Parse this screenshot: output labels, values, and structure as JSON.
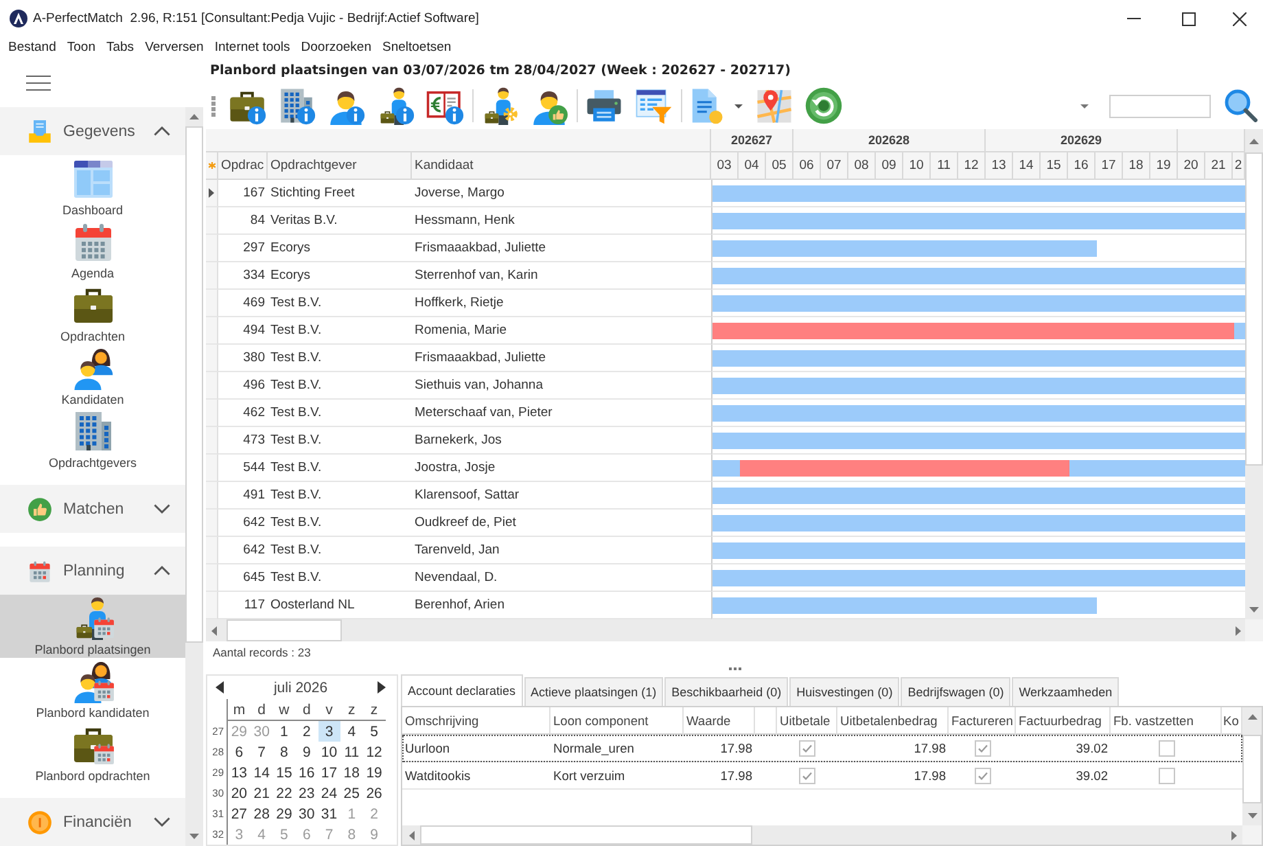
{
  "window": {
    "title": "A-PerfectMatch  2.96, R:151 [Consultant:Pedja Vujic - Bedrijf:Actief Software]"
  },
  "menu": [
    "Bestand",
    "Toon",
    "Tabs",
    "Verversen",
    "Internet tools",
    "Doorzoeken",
    "Sneltoetsen"
  ],
  "sidebar": {
    "sections": [
      {
        "label": "Gegevens",
        "kind": "data",
        "expanded": true,
        "items": [
          {
            "label": "Dashboard",
            "kind": "dashboard",
            "selected": false
          },
          {
            "label": "Agenda",
            "kind": "agenda",
            "selected": false
          },
          {
            "label": "Opdrachten",
            "kind": "assignments",
            "selected": false
          },
          {
            "label": "Kandidaten",
            "kind": "candidates",
            "selected": false
          },
          {
            "label": "Opdrachtgevers",
            "kind": "clients",
            "selected": false
          }
        ]
      },
      {
        "label": "Matchen",
        "kind": "matching",
        "expanded": false
      },
      {
        "label": "Planning",
        "kind": "planning",
        "expanded": true,
        "items": [
          {
            "label": "Planbord plaatsingen",
            "kind": "placementboard",
            "selected": true
          },
          {
            "label": "Planbord kandidaten",
            "kind": "candidateboard",
            "selected": false
          },
          {
            "label": "Planbord opdrachten",
            "kind": "assignmentboard",
            "selected": false
          }
        ]
      },
      {
        "label": "Financiën",
        "kind": "finance",
        "expanded": false
      }
    ]
  },
  "planboard": {
    "title": "Planbord plaatsingen van 03/07/2026 tm 28/04/2027 (Week : 202627 - 202717)",
    "columns": [
      "Opdrac",
      "Opdrachtgever",
      "Kandidaat"
    ],
    "weeks": [
      {
        "label": "202627",
        "days": [
          "03",
          "04",
          "05"
        ]
      },
      {
        "label": "202628",
        "days": [
          "06",
          "07",
          "08",
          "09",
          "10",
          "11",
          "12"
        ]
      },
      {
        "label": "202629",
        "days": [
          "13",
          "14",
          "15",
          "16",
          "17",
          "18",
          "19"
        ]
      },
      {
        "days": [
          "20",
          "21",
          "2"
        ]
      }
    ],
    "rows": [
      {
        "nr": "167",
        "client": "Stichting Freet",
        "candidate": "Joverse, Margo",
        "current": true,
        "bars": [
          {
            "color": "#9ccbfa",
            "level": 1
          }
        ]
      },
      {
        "nr": "84",
        "client": "Veritas B.V.",
        "candidate": "Hessmann, Henk",
        "current": false,
        "bars": [
          {
            "color": "#9ccbfa",
            "level": 1
          }
        ]
      },
      {
        "nr": "297",
        "client": "Ecorys",
        "candidate": "Frismaaakbad, Juliette",
        "current": false,
        "bars": [
          {
            "color": "#9ccbfa",
            "level": 0.722
          }
        ]
      },
      {
        "nr": "334",
        "client": "Ecorys",
        "candidate": "Sterrenhof van, Karin",
        "current": false,
        "bars": [
          {
            "color": "#9ccbfa",
            "level": 1
          }
        ]
      },
      {
        "nr": "469",
        "client": "Test B.V.",
        "candidate": "Hoffkerk, Rietje",
        "current": false,
        "bars": [
          {
            "color": "#9ccbfa",
            "level": 1
          }
        ]
      },
      {
        "nr": "494",
        "client": "Test B.V.",
        "candidate": "Romenia, Marie",
        "current": false,
        "bars": [
          {
            "color": "#ff8080",
            "level": 0.979
          },
          {
            "color": "#9ccbfa",
            "level": 0.021
          }
        ]
      },
      {
        "nr": "380",
        "client": "Test B.V.",
        "candidate": "Frismaaakbad, Juliette",
        "current": false,
        "bars": [
          {
            "color": "#9ccbfa",
            "level": 1
          }
        ]
      },
      {
        "nr": "496",
        "client": "Test B.V.",
        "candidate": "Siethuis van, Johanna",
        "current": false,
        "bars": [
          {
            "color": "#9ccbfa",
            "level": 1
          }
        ]
      },
      {
        "nr": "462",
        "client": "Test B.V.",
        "candidate": "Meterschaaf van, Pieter",
        "current": false,
        "bars": [
          {
            "color": "#9ccbfa",
            "level": 1
          }
        ]
      },
      {
        "nr": "473",
        "client": "Test B.V.",
        "candidate": "Barnekerk, Jos",
        "current": false,
        "bars": [
          {
            "color": "#9ccbfa",
            "level": 1
          }
        ]
      },
      {
        "nr": "544",
        "client": "Test B.V.",
        "candidate": "Joostra, Josje",
        "current": false,
        "bars": [
          {
            "color": "#9ccbfa",
            "level": 0.052
          },
          {
            "color": "#ff8080"
          },
          {
            "color": "#9ccbfa",
            "level": 0.329
          }
        ]
      },
      {
        "nr": "491",
        "client": "Test B.V.",
        "candidate": "Klarensoof, Sattar",
        "current": false,
        "bars": [
          {
            "color": "#9ccbfa",
            "level": 1
          }
        ]
      },
      {
        "nr": "642",
        "client": "Test B.V.",
        "candidate": "Oudkreef de, Piet",
        "current": false,
        "bars": [
          {
            "color": "#9ccbfa",
            "level": 1
          }
        ]
      },
      {
        "nr": "642",
        "client": "Test B.V.",
        "candidate": "Tarenveld, Jan",
        "current": false,
        "bars": [
          {
            "color": "#9ccbfa",
            "level": 1
          }
        ]
      },
      {
        "nr": "645",
        "client": "Test B.V.",
        "candidate": "Nevendaal, D.",
        "current": false,
        "bars": [
          {
            "color": "#9ccbfa",
            "level": 1
          }
        ]
      },
      {
        "nr": "117",
        "client": "Oosterland NL",
        "candidate": "Berenhof, Arien",
        "current": false,
        "bars": [
          {
            "color": "#9ccbfa",
            "level": 0.722
          }
        ]
      }
    ],
    "record_count": "Aantal records : 23"
  },
  "calendar": {
    "month": "juli 2026",
    "weekdays": [
      "m",
      "d",
      "w",
      "d",
      "v",
      "z",
      "z"
    ],
    "weeks": [
      {
        "number": "27",
        "days": [
          {
            "day": "29",
            "outside": true,
            "selected": false
          },
          {
            "day": "30",
            "outside": true,
            "selected": false
          },
          {
            "day": "1",
            "outside": false,
            "selected": false
          },
          {
            "day": "2",
            "outside": false,
            "selected": false
          },
          {
            "day": "3",
            "outside": false,
            "selected": true
          },
          {
            "day": "4",
            "outside": false,
            "selected": false
          },
          {
            "day": "5",
            "outside": false,
            "selected": false
          }
        ]
      },
      {
        "number": "28",
        "days": [
          {
            "day": "6",
            "outside": false,
            "selected": false
          },
          {
            "day": "7",
            "outside": false,
            "selected": false
          },
          {
            "day": "8",
            "outside": false,
            "selected": false
          },
          {
            "day": "9",
            "outside": false,
            "selected": false
          },
          {
            "day": "10",
            "outside": false,
            "selected": false
          },
          {
            "day": "11",
            "outside": false,
            "selected": false
          },
          {
            "day": "12",
            "outside": false,
            "selected": false
          }
        ]
      },
      {
        "number": "29",
        "days": [
          {
            "day": "13",
            "outside": false,
            "selected": false
          },
          {
            "day": "14",
            "outside": false,
            "selected": false
          },
          {
            "day": "15",
            "outside": false,
            "selected": false
          },
          {
            "day": "16",
            "outside": false,
            "selected": false
          },
          {
            "day": "17",
            "outside": false,
            "selected": false
          },
          {
            "day": "18",
            "outside": false,
            "selected": false
          },
          {
            "day": "19",
            "outside": false,
            "selected": false
          }
        ]
      },
      {
        "number": "30",
        "days": [
          {
            "day": "20",
            "outside": false,
            "selected": false
          },
          {
            "day": "21",
            "outside": false,
            "selected": false
          },
          {
            "day": "22",
            "outside": false,
            "selected": false
          },
          {
            "day": "23",
            "outside": false,
            "selected": false
          },
          {
            "day": "24",
            "outside": false,
            "selected": false
          },
          {
            "day": "25",
            "outside": false,
            "selected": false
          },
          {
            "day": "26",
            "outside": false,
            "selected": false
          }
        ]
      },
      {
        "number": "31",
        "days": [
          {
            "day": "27",
            "outside": false,
            "selected": false
          },
          {
            "day": "28",
            "outside": false,
            "selected": false
          },
          {
            "day": "29",
            "outside": false,
            "selected": false
          },
          {
            "day": "30",
            "outside": false,
            "selected": false
          },
          {
            "day": "31",
            "outside": false,
            "selected": false
          },
          {
            "day": "1",
            "outside": true,
            "selected": false
          },
          {
            "day": "2",
            "outside": true,
            "selected": false
          }
        ]
      },
      {
        "number": "32",
        "days": [
          {
            "day": "3",
            "outside": true,
            "selected": false
          },
          {
            "day": "4",
            "outside": true,
            "selected": false
          },
          {
            "day": "5",
            "outside": true,
            "selected": false
          },
          {
            "day": "6",
            "outside": true,
            "selected": false
          },
          {
            "day": "7",
            "outside": true,
            "selected": false
          },
          {
            "day": "8",
            "outside": true,
            "selected": false
          },
          {
            "day": "9",
            "outside": true,
            "selected": false
          }
        ]
      }
    ]
  },
  "tabs": [
    {
      "label": "Account declaraties",
      "selected": true
    },
    {
      "label": "Actieve plaatsingen (1)",
      "selected": false
    },
    {
      "label": "Beschikbaarheid (0)",
      "selected": false
    },
    {
      "label": "Huisvestingen (0)",
      "selected": false
    },
    {
      "label": "Bedrijfswagen (0)",
      "selected": false
    },
    {
      "label": "Werkzaamheden",
      "selected": false
    }
  ],
  "declarations": {
    "columns": [
      "Omschrijving",
      "Loon component",
      "Waarde",
      "Uitbetale",
      "Uitbetalenbedrag",
      "Factureren",
      "Factuurbedrag",
      "Fb. vastzetten",
      "Ko"
    ],
    "rows": [
      {
        "description": "Uurloon",
        "component": "Normale_uren",
        "value": "17.98",
        "pay_out": true,
        "pay_amount": "17.98",
        "invoice": true,
        "invoice_amount": "39.02",
        "lock": false,
        "current": true
      },
      {
        "description": "Watditookis",
        "component": "Kort verzuim",
        "value": "17.98",
        "pay_out": true,
        "pay_amount": "17.98",
        "invoice": true,
        "invoice_amount": "39.02",
        "lock": false,
        "current": false
      }
    ]
  }
}
